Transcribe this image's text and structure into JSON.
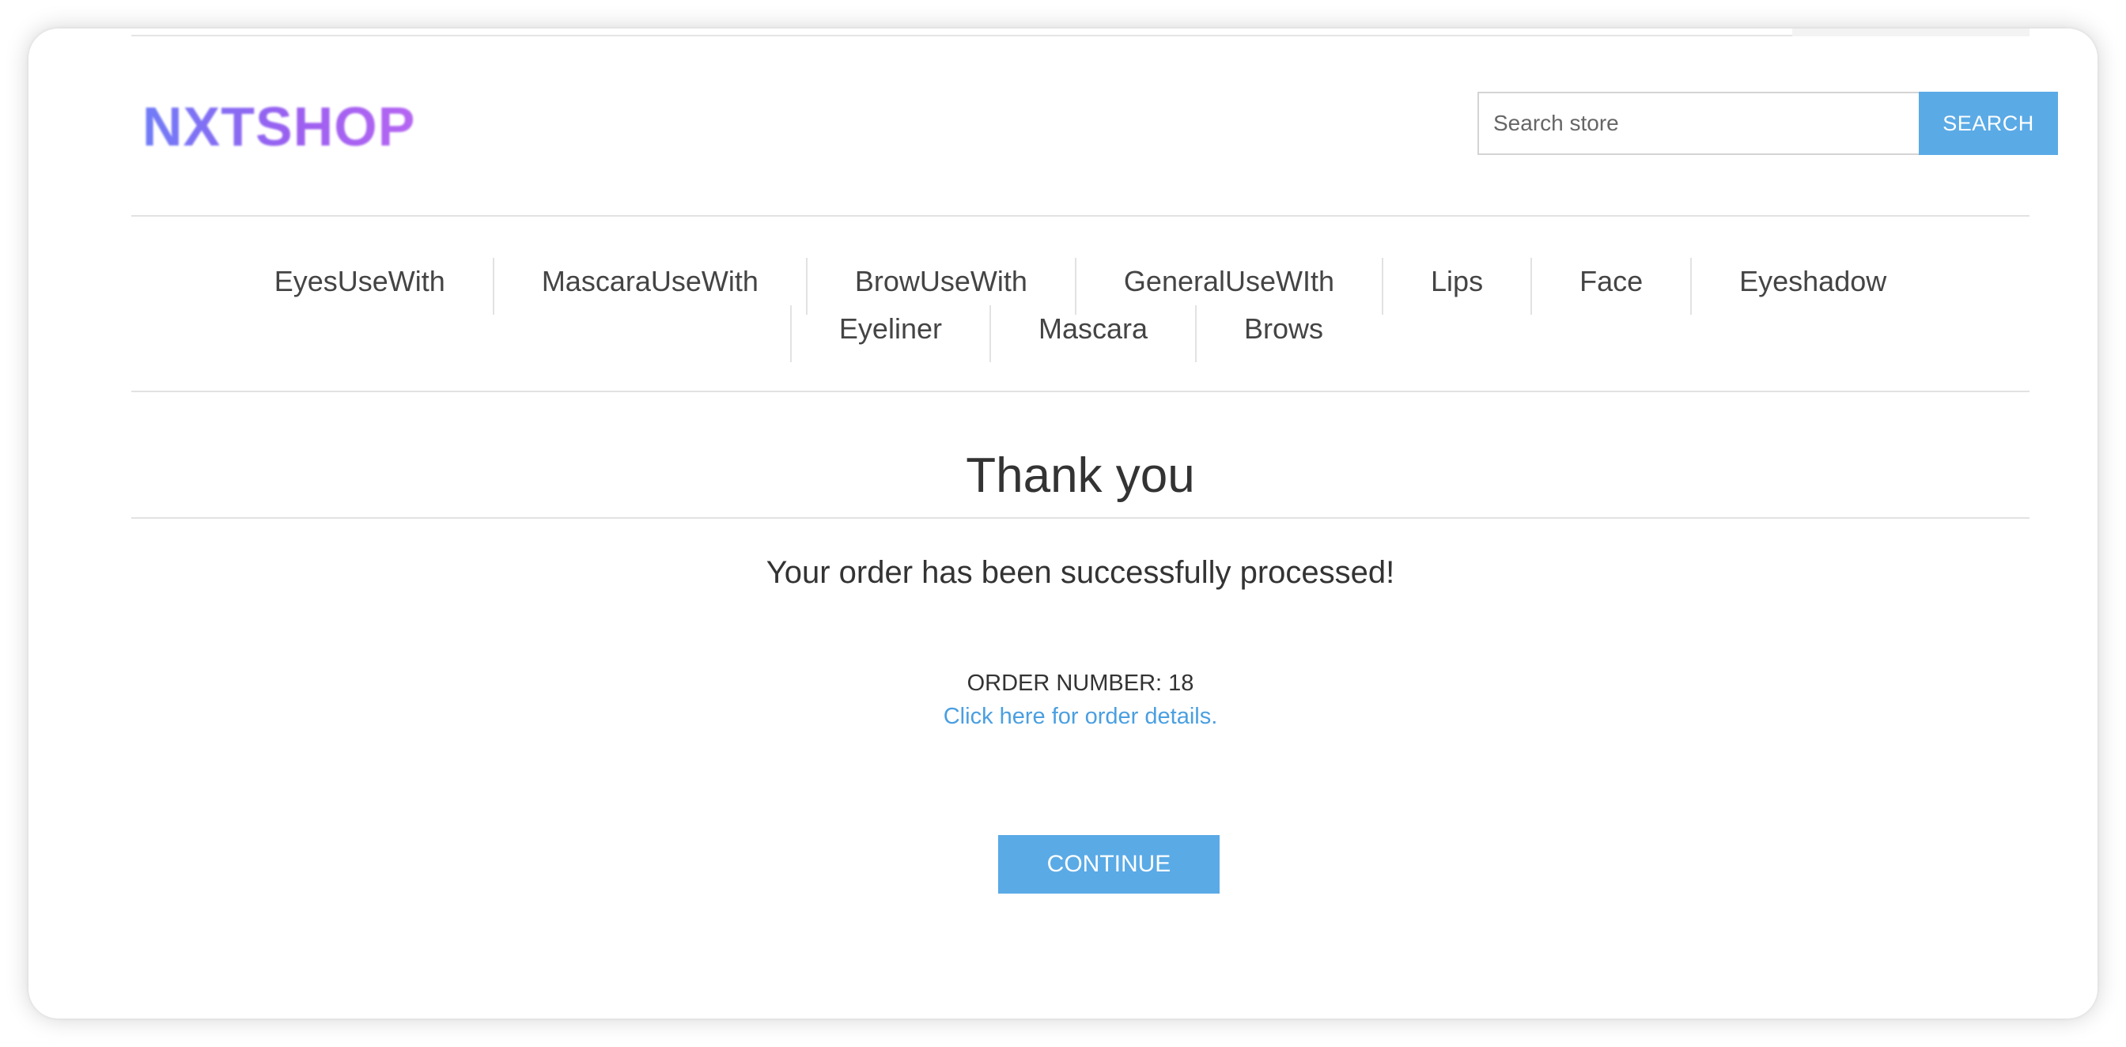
{
  "header": {
    "logo_text": "NXTSHOP",
    "search": {
      "placeholder": "Search store",
      "value": "",
      "button_label": "SEARCH"
    }
  },
  "nav": {
    "row1": [
      "EyesUseWith",
      "MascaraUseWith",
      "BrowUseWith",
      "GeneralUseWIth",
      "Lips",
      "Face",
      "Eyeshadow"
    ],
    "row2": [
      "Eyeliner",
      "Mascara",
      "Brows"
    ]
  },
  "main": {
    "title": "Thank you",
    "message": "Your order has been successfully processed!",
    "order_number": "ORDER NUMBER: 18",
    "order_details_link": "Click here for order details.",
    "continue_label": "CONTINUE"
  },
  "colors": {
    "accent": "#5aaae6",
    "link": "#4a9fe0",
    "logo_gradient_start": "#6f7cf7",
    "logo_gradient_end": "#b565f2"
  }
}
